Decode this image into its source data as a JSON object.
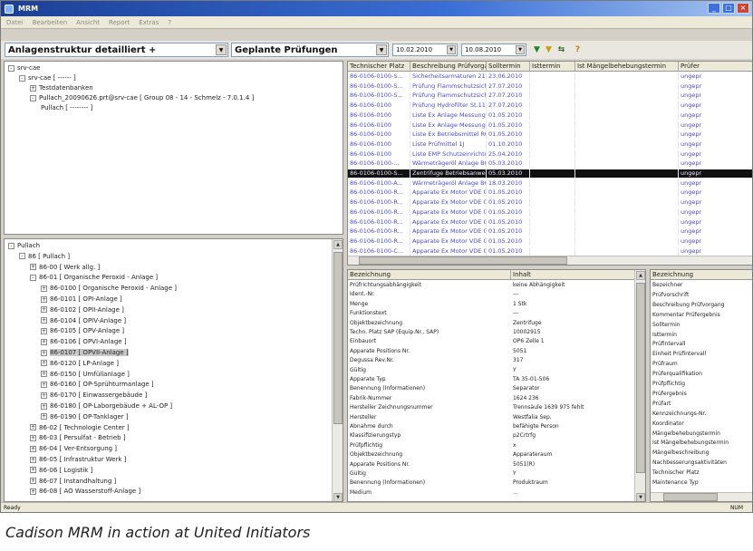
{
  "window": {
    "title": "MRM"
  },
  "menu": [
    "Datei",
    "Bearbeiten",
    "Ansicht",
    "Report",
    "Extras",
    "?"
  ],
  "toolbar": {
    "structure_select": "Anlagenstruktur detailliert +",
    "inspection_select": "Geplante Prüfungen",
    "date_from": "10.02.2010",
    "date_to": "10.08.2010"
  },
  "upper_tree": [
    {
      "label": "srv-cae",
      "depth": 0,
      "exp": "-"
    },
    {
      "label": "srv-cae   [ ------ ]",
      "depth": 1,
      "exp": "-"
    },
    {
      "label": "Testdatenbanken",
      "depth": 2,
      "exp": "+"
    },
    {
      "label": "Pullach_20090626.prt@srv-cae   [ Group 08 - 14 - Schmelz - 7.0.1.4 ]",
      "depth": 2,
      "exp": "-"
    },
    {
      "label": "Pullach   [ -------- ]",
      "depth": 3,
      "exp": ""
    }
  ],
  "lower_tree": [
    {
      "label": "Pullach",
      "depth": 0,
      "exp": "-"
    },
    {
      "label": "86   [ Pullach ]",
      "depth": 1,
      "exp": "-"
    },
    {
      "label": "86-00   [ Werk allg. ]",
      "depth": 2,
      "exp": "+"
    },
    {
      "label": "86-01   [ Organische Peroxid - Anlage ]",
      "depth": 2,
      "exp": "-"
    },
    {
      "label": "86-0100   [ Organische Peroxid - Anlage ]",
      "depth": 3,
      "exp": "+"
    },
    {
      "label": "86-0101   [ OPI-Anlage ]",
      "depth": 3,
      "exp": "+"
    },
    {
      "label": "86-0102   [ OPII-Anlage ]",
      "depth": 3,
      "exp": "+"
    },
    {
      "label": "86-0104   [ OPIV-Anlage ]",
      "depth": 3,
      "exp": "+"
    },
    {
      "label": "86-0105   [ OPV-Anlage ]",
      "depth": 3,
      "exp": "+"
    },
    {
      "label": "86-0106   [ OPVI-Anlage ]",
      "depth": 3,
      "exp": "+"
    },
    {
      "label": "86-0107   [ OPVII-Anlage ]",
      "depth": 3,
      "exp": "+",
      "selected": true
    },
    {
      "label": "86-0120   [ LP-Anlage ]",
      "depth": 3,
      "exp": "+"
    },
    {
      "label": "86-0150   [ Umfüllanlage ]",
      "depth": 3,
      "exp": "+"
    },
    {
      "label": "86-0160   [ OP-Sprühturmanlage ]",
      "depth": 3,
      "exp": "+"
    },
    {
      "label": "86-0170   [ Einwassergebäude ]",
      "depth": 3,
      "exp": "+"
    },
    {
      "label": "86-0180   [ OP-Laborgebäude + AL-OP ]",
      "depth": 3,
      "exp": "+"
    },
    {
      "label": "86-0190   [ OP-Tanklager ]",
      "depth": 3,
      "exp": "+"
    },
    {
      "label": "86-02   [ Technologie Center ]",
      "depth": 2,
      "exp": "+"
    },
    {
      "label": "86-03   [ Persulfat - Betrieb ]",
      "depth": 2,
      "exp": "+"
    },
    {
      "label": "86-04   [ Ver-Entsorgung ]",
      "depth": 2,
      "exp": "+"
    },
    {
      "label": "86-05   [ Infrastruktur Werk ]",
      "depth": 2,
      "exp": "+"
    },
    {
      "label": "86-06   [ Logistik ]",
      "depth": 2,
      "exp": "+"
    },
    {
      "label": "86-07   [ Instandhaltung ]",
      "depth": 2,
      "exp": "+"
    },
    {
      "label": "86-08   [ AO Wasserstoff-Anlage ]",
      "depth": 2,
      "exp": "+"
    }
  ],
  "inspection_grid": {
    "columns": [
      "Technischer Platz",
      "Beschreibung Prüfvorgang",
      "Solltermin",
      "Isttermin",
      "Ist Mängelbehebungstermin",
      "Prüfer"
    ],
    "rows": [
      [
        "86-0106-0100-S...",
        "Sicherheitsarmaturen 21",
        "23.06.2010",
        "",
        "",
        "ungepr"
      ],
      [
        "86-0106-0100-S...",
        "Prüfung Flammschutzsich...",
        "27.07.2010",
        "",
        "",
        "ungepr"
      ],
      [
        "86-0106-0100-S...",
        "Prüfung Flammschutzsich...",
        "27.07.2010",
        "",
        "",
        "ungepr"
      ],
      [
        "86-0106-0100",
        "Prüfung Hydrofilter St.11",
        "27.07.2010",
        "",
        "",
        "ungepr"
      ],
      [
        "86-0106-0100",
        "Liste Ex Anlage Messung ...",
        "01.05.2010",
        "",
        "",
        "ungepr"
      ],
      [
        "86-0106-0100",
        "Liste Ex Anlage Messung ...",
        "01.05.2010",
        "",
        "",
        "ungepr"
      ],
      [
        "86-0106-0100",
        "Liste Ex Betriebsmittel RC...",
        "01.05.2010",
        "",
        "",
        "ungepr"
      ],
      [
        "86-0106-0100",
        "Liste Prüfmittel 1J",
        "01.10.2010",
        "",
        "",
        "ungepr"
      ],
      [
        "86-0106-0100",
        "Liste EMP Schutzeinrichtu...",
        "25.04.2010",
        "",
        "",
        "ungepr"
      ],
      [
        "86-0106-0100-...",
        "Wärmeträgeröl Anlage BG...",
        "05.03.2010",
        "",
        "",
        "ungepr"
      ],
      [
        "86-0106-0100-S...",
        "Zentrifuge Betriebsanwei...",
        "05.03.2010",
        "",
        "",
        "ungepr"
      ],
      [
        "86-0106-0100-A...",
        "Wärmeträgeröl Anlage BG...",
        "18.03.2010",
        "",
        "",
        "ungepr"
      ],
      [
        "86-0106-0100-R...",
        "Apparate Ex Motor VDE 0...",
        "01.05.2010",
        "",
        "",
        "ungepr"
      ],
      [
        "86-0106-0100-R...",
        "Apparate Ex Motor VDE 0...",
        "01.05.2010",
        "",
        "",
        "ungepr"
      ],
      [
        "86-0106-0100-R...",
        "Apparate Ex Motor VDE 0...",
        "01.05.2010",
        "",
        "",
        "ungepr"
      ],
      [
        "86-0106-0100-R...",
        "Apparate Ex Motor VDE 0...",
        "01.05.2010",
        "",
        "",
        "ungepr"
      ],
      [
        "86-0106-0100-R...",
        "Apparate Ex Motor VDE 0...",
        "01.05.2010",
        "",
        "",
        "ungepr"
      ],
      [
        "86-0106-0100-R...",
        "Apparate Ex Motor VDE 0...",
        "01.05.2010",
        "",
        "",
        "ungepr"
      ],
      [
        "86-0106-0100-C...",
        "Apparate Ex Motor VDE 0...",
        "01.05.2010",
        "",
        "",
        "ungepr"
      ]
    ]
  },
  "properties": {
    "columns": [
      "Bezeichnung",
      "Inhalt"
    ],
    "rows": [
      [
        "Prüfrichtungsabhängigkeit",
        "keine Abhängigkeit"
      ],
      [
        "Ident.-Nr.",
        "---"
      ],
      [
        "Menge",
        "1 Stk"
      ],
      [
        "Funktionstext",
        "---"
      ],
      [
        "Objektbezeichnung",
        "Zentrifuge"
      ],
      [
        "Techn. Platz SAP (Equip.Nr., SAP)",
        "10002915"
      ],
      [
        "Einbauort",
        "OP6 Zelle 1"
      ],
      [
        "Apparate Positions Nr.",
        "5051"
      ],
      [
        "Degussa Rev.Nr.",
        "317"
      ],
      [
        "Gültig",
        "Y"
      ],
      [
        "Apparate Typ",
        "TA 35-01-506"
      ],
      [
        "Benennung (Informationen)",
        "Separator"
      ],
      [
        "Fabrik-Nummer",
        "1624 236"
      ],
      [
        "Hersteller Zeichnungsnummer",
        "Trennsäule 1639 975 fehlt"
      ],
      [
        "Hersteller",
        "Westfalia Sep."
      ],
      [
        "Abnahme durch",
        "befähigte Person"
      ],
      [
        "Klassifizierungstyp",
        "p2Crtrfg"
      ],
      [
        "Prüfpflichtig",
        "x"
      ],
      [
        "Objektbezeichnung",
        "Apparateraum"
      ],
      [
        "Apparate Positions Nr.",
        "5051(R)"
      ],
      [
        "Gültig",
        "Y"
      ],
      [
        "Benennung (Informationen)",
        "Produktraum"
      ],
      [
        "Medium",
        "..."
      ]
    ]
  },
  "right_panel": {
    "header": "Bezeichnung",
    "rows": [
      "Bezeichner",
      "Prüfvorschrift",
      "Beschreibung Prüfvorgang",
      "Kommentar Prüfergebnis",
      "Solltermin",
      "Isttermin",
      "Prüfintervall",
      "Einheit Prüfintervall",
      "Prüfraum",
      "Prüferqualifikation",
      "Prüfpflichtig",
      "Prüfergebnis",
      "Prüfart",
      "Kennzeichnungs-Nr.",
      "Koordinator",
      "Mängelbehebungstermin",
      "Ist Mängelbehebungstermin",
      "Mängelbeschreibung",
      "Nachbesserungsaktivitäten",
      "Technischer Platz",
      "Maintenance Typ"
    ]
  },
  "status": {
    "left": "Ready",
    "right": "NUM"
  },
  "caption": "Cadison MRM in action at United Initiators"
}
